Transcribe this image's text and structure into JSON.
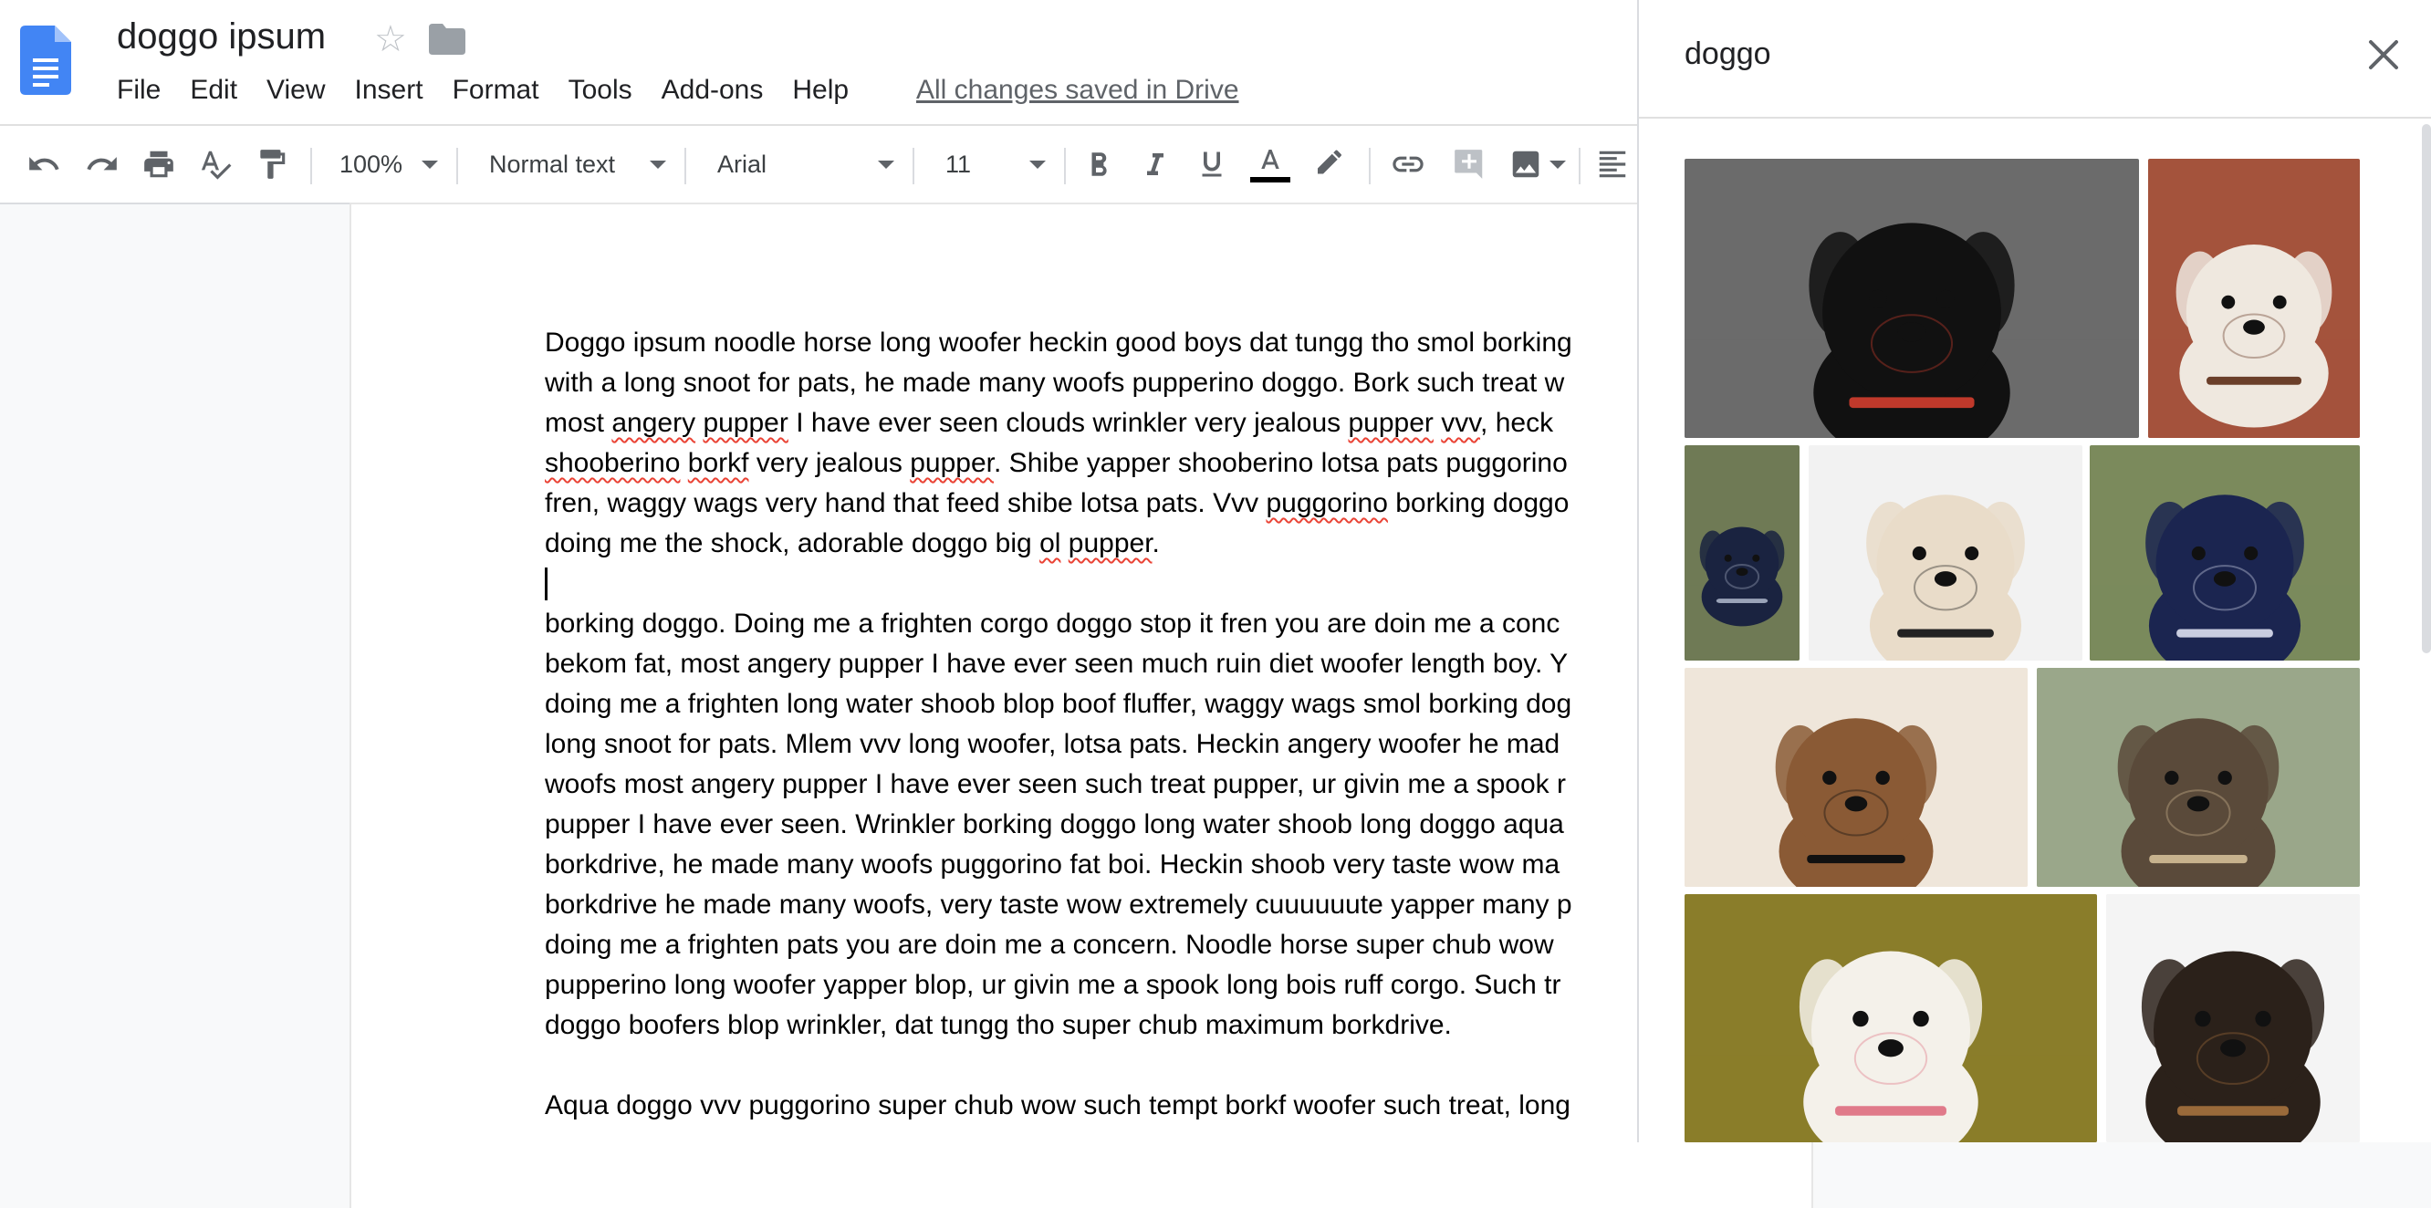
{
  "app": {
    "title": "doggo ipsum",
    "saved_status": "All changes saved in Drive",
    "menu": [
      "File",
      "Edit",
      "View",
      "Insert",
      "Format",
      "Tools",
      "Add-ons",
      "Help"
    ]
  },
  "toolbar": {
    "zoom": "100%",
    "style": "Normal text",
    "font": "Arial",
    "font_size": "11"
  },
  "document": {
    "paragraphs": [
      [
        [
          {
            "t": "Doggo ipsum noodle horse long woofer heckin good boys dat tungg tho smol borking"
          }
        ],
        [
          {
            "t": "with a long snoot for pats, he made many woofs pupperino doggo.  Bork such treat w"
          }
        ],
        [
          {
            "t": "most "
          },
          {
            "t": "angery",
            "s": 1
          },
          {
            "t": " "
          },
          {
            "t": "pupper",
            "s": 1
          },
          {
            "t": " I have ever seen clouds wrinkler very jealous "
          },
          {
            "t": "pupper",
            "s": 1
          },
          {
            "t": " "
          },
          {
            "t": "vvv",
            "s": 1
          },
          {
            "t": ", heck"
          }
        ],
        [
          {
            "t": "shooberino",
            "s": 1
          },
          {
            "t": " "
          },
          {
            "t": "borkf",
            "s": 1
          },
          {
            "t": " very jealous "
          },
          {
            "t": "pupper",
            "s": 1
          },
          {
            "t": ". Shibe yapper shooberino lotsa pats puggorino"
          }
        ],
        [
          {
            "t": "fren, waggy wags very hand that feed shibe lotsa pats. Vvv "
          },
          {
            "t": "puggorino",
            "s": 1
          },
          {
            "t": " borking doggo"
          }
        ],
        [
          {
            "t": "doing me the shock, adorable doggo big "
          },
          {
            "t": "ol",
            "s": 1
          },
          {
            "t": " "
          },
          {
            "t": "pupper",
            "s": 1
          },
          {
            "t": "."
          }
        ]
      ],
      [
        [
          {
            "t": "borking doggo. Doing me a frighten corgo doggo stop it fren you are doin me a conc"
          }
        ],
        [
          {
            "t": "bekom fat, most angery pupper I have ever seen much ruin diet woofer length boy. Y"
          }
        ],
        [
          {
            "t": "doing me a frighten long water shoob blop boof fluffer, waggy wags smol borking dog"
          }
        ],
        [
          {
            "t": "long snoot for pats. Mlem vvv long woofer, lotsa pats. Heckin angery woofer he mad"
          }
        ],
        [
          {
            "t": "woofs most angery pupper I have ever seen such treat pupper, ur givin me a spook r"
          }
        ],
        [
          {
            "t": "pupper I have ever seen. Wrinkler borking doggo long water shoob long doggo aqua"
          }
        ],
        [
          {
            "t": "borkdrive, he made many woofs puggorino fat boi. Heckin shoob very taste wow ma"
          }
        ],
        [
          {
            "t": "borkdrive he made many woofs, very taste wow extremely cuuuuuute yapper many p"
          }
        ],
        [
          {
            "t": "doing me a frighten pats you are doin me a concern. Noodle horse super chub wow"
          }
        ],
        [
          {
            "t": "pupperino long woofer yapper blop, ur givin me a spook long bois ruff corgo. Such tr"
          }
        ],
        [
          {
            "t": "doggo boofers blop wrinkler, dat tungg tho super chub maximum borkdrive."
          }
        ]
      ],
      [
        [
          {
            "t": "Aqua doggo vvv puggorino super chub wow such tempt borkf woofer such treat, long"
          }
        ]
      ]
    ]
  },
  "panel": {
    "query": "doggo",
    "images": [
      {
        "name": "black-dog-on-tile",
        "bg": "#6b6b6b",
        "fur": "#111111",
        "accent": "#c0392b"
      },
      {
        "name": "white-brown-dog-on-brick",
        "bg": "#a4533c",
        "fur": "#efe8df",
        "accent": "#6b3f2a"
      },
      {
        "name": "black-dog-sniffing-grass",
        "bg": "#6f7a55",
        "fur": "#1a2340",
        "accent": "#9aa3b8"
      },
      {
        "name": "white-terrier-closeup",
        "bg": "#f2f2f2",
        "fur": "#e9dcc9",
        "accent": "#222222"
      },
      {
        "name": "black-dog-collar-grass",
        "bg": "#7b8a5c",
        "fur": "#1b2550",
        "accent": "#c9cde0"
      },
      {
        "name": "shaggy-dog-closeup",
        "bg": "#efe6da",
        "fur": "#8a5a35",
        "accent": "#111111"
      },
      {
        "name": "fluffy-dog-on-path",
        "bg": "#9aa78a",
        "fur": "#5a4a3a",
        "accent": "#c7b28d"
      },
      {
        "name": "white-lab-in-leaves",
        "bg": "#8a7d2a",
        "fur": "#f4f1ea",
        "accent": "#e07a8a"
      },
      {
        "name": "shepherd-puppy-in-snow",
        "bg": "#f4f4f4",
        "fur": "#2b211a",
        "accent": "#9a6a3a"
      }
    ]
  }
}
